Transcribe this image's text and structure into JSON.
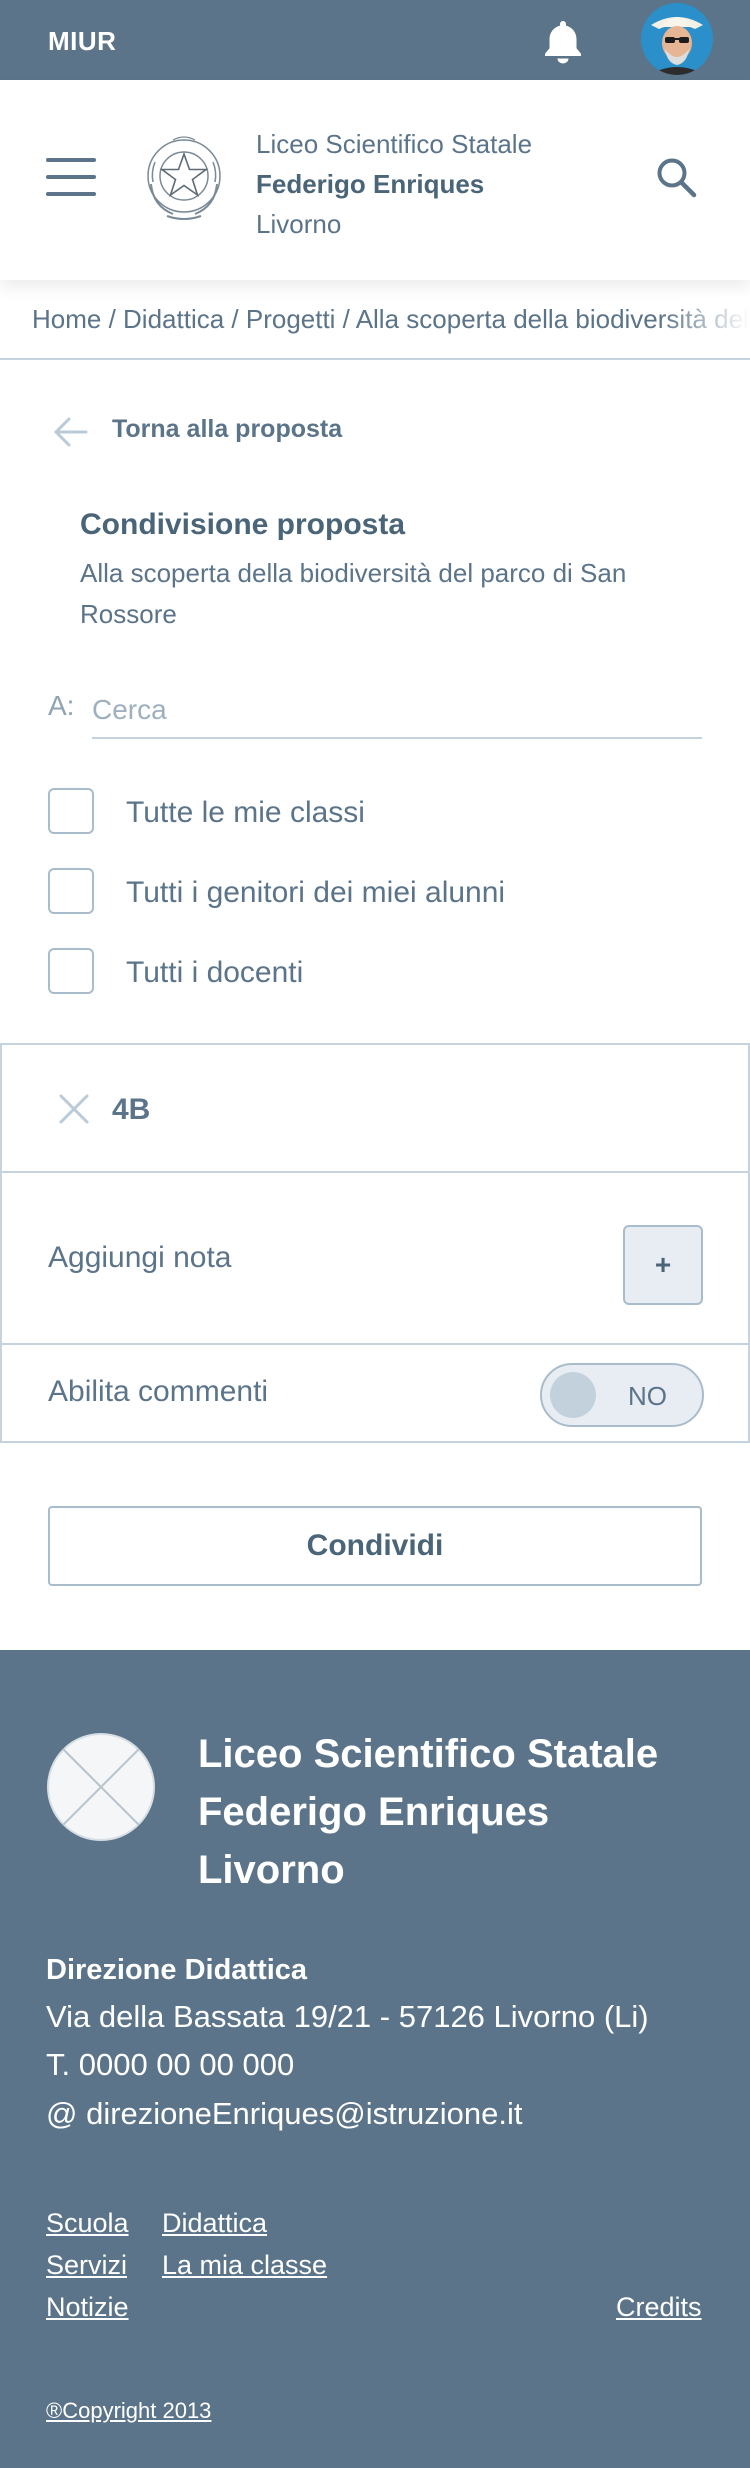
{
  "topbar": {
    "brand": "MIUR",
    "bell_icon": "bell-icon",
    "avatar_icon": "avatar"
  },
  "header": {
    "school_line1": "Liceo Scientifico Statale",
    "school_name": "Federigo Enriques",
    "school_city": "Livorno",
    "menu_icon": "hamburger-menu-icon",
    "search_icon": "search-icon",
    "emblem_icon": "republic-emblem-icon"
  },
  "breadcrumb": {
    "text": "Home / Didattica / Progetti / Alla scoperta della biodiversità del parco di San Rossore"
  },
  "back": {
    "label": "Torna alla proposta"
  },
  "share": {
    "title": "Condivisione proposta",
    "subtitle": "Alla scoperta della biodiversità del parco di San Rossore"
  },
  "recipients": {
    "to_label": "A:",
    "search_placeholder": "Cerca",
    "options": [
      {
        "label": "Tutte le mie classi",
        "checked": false
      },
      {
        "label": "Tutti i genitori dei miei alunni",
        "checked": false
      },
      {
        "label": "Tutti i docenti",
        "checked": false
      }
    ]
  },
  "selected": {
    "tag": "4B"
  },
  "note": {
    "label": "Aggiungi nota",
    "button": "+"
  },
  "comments": {
    "label": "Abilita commenti",
    "toggle_state": "NO",
    "enabled": false
  },
  "actions": {
    "share_button": "Condividi"
  },
  "footer": {
    "school_line1": "Liceo Scientifico Statale",
    "school_line2": "Federigo Enriques",
    "school_line3": "Livorno",
    "direction_title": "Direzione Didattica",
    "address": "Via della Bassata 19/21 - 57126 Livorno (Li)",
    "phone": "T. 0000 00 00 000",
    "email": "@ direzioneEnriques@istruzione.it",
    "links": [
      "Scuola",
      "Didattica",
      "Servizi",
      "La mia classe",
      "Notizie",
      "Credits"
    ],
    "copyright": "®Copyright 2013"
  },
  "colors": {
    "primary": "#5b7489",
    "text_dark": "#4a6478",
    "border": "#c5d3df",
    "control_fill": "#e7edf2",
    "white": "#ffffff"
  }
}
